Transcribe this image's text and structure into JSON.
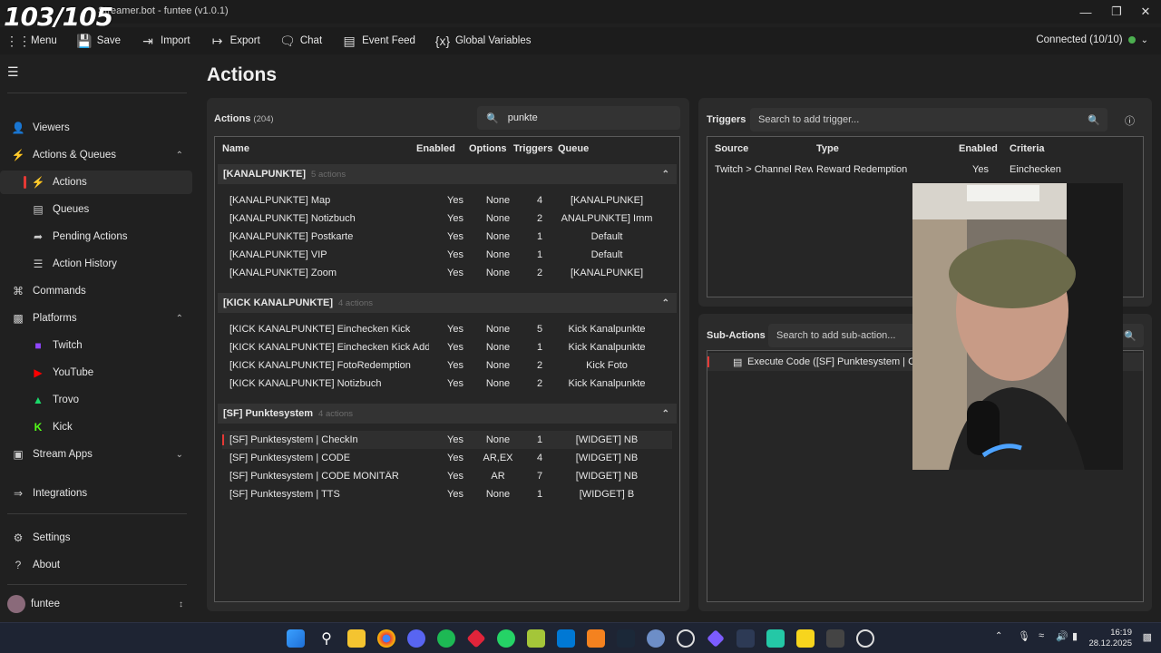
{
  "overlay_counter": "103/105",
  "window": {
    "title": "Streamer.bot - funtee (v1.0.1)"
  },
  "menu": [
    {
      "label": "Menu",
      "icon": "grid-icon"
    },
    {
      "label": "Save",
      "icon": "save-icon"
    },
    {
      "label": "Import",
      "icon": "import-icon"
    },
    {
      "label": "Export",
      "icon": "export-icon"
    },
    {
      "label": "Chat",
      "icon": "chat-icon"
    },
    {
      "label": "Event Feed",
      "icon": "event-feed-icon"
    },
    {
      "label": "Global Variables",
      "icon": "variables-icon"
    }
  ],
  "connection": {
    "label": "Connected (10/10)",
    "color": "#4caf50"
  },
  "sidebar": {
    "items": [
      {
        "label": "Viewers",
        "icon": "viewers-icon"
      },
      {
        "label": "Actions & Queues",
        "icon": "actions-icon"
      },
      {
        "label": "Actions",
        "icon": "bolt-icon"
      },
      {
        "label": "Queues",
        "icon": "queues-icon"
      },
      {
        "label": "Pending Actions",
        "icon": "pending-icon"
      },
      {
        "label": "Action History",
        "icon": "history-icon"
      },
      {
        "label": "Commands",
        "icon": "command-icon"
      },
      {
        "label": "Platforms",
        "icon": "platforms-icon"
      },
      {
        "label": "Twitch",
        "icon": "twitch-icon"
      },
      {
        "label": "YouTube",
        "icon": "youtube-icon"
      },
      {
        "label": "Trovo",
        "icon": "trovo-icon"
      },
      {
        "label": "Kick",
        "icon": "kick-icon"
      },
      {
        "label": "Stream Apps",
        "icon": "stream-apps-icon"
      },
      {
        "label": "Integrations",
        "icon": "integrations-icon"
      },
      {
        "label": "Settings",
        "icon": "settings-icon"
      },
      {
        "label": "About",
        "icon": "about-icon"
      }
    ],
    "user": "funtee"
  },
  "page_title": "Actions",
  "actions": {
    "title": "Actions",
    "count": "(204)",
    "search_value": "punkte",
    "columns": [
      "Name",
      "Enabled",
      "Options",
      "Triggers",
      "Queue"
    ],
    "groups": [
      {
        "name": "[KANALPUNKTE]",
        "count": "5 actions",
        "rows": [
          [
            "[KANALPUNKTE] Map",
            "Yes",
            "None",
            "4",
            "[KANALPUNKE]"
          ],
          [
            "[KANALPUNKTE] Notizbuch",
            "Yes",
            "None",
            "2",
            "ANALPUNKTE] Imm"
          ],
          [
            "[KANALPUNKTE] Postkarte",
            "Yes",
            "None",
            "1",
            "Default"
          ],
          [
            "[KANALPUNKTE] VIP",
            "Yes",
            "None",
            "1",
            "Default"
          ],
          [
            "[KANALPUNKTE] Zoom",
            "Yes",
            "None",
            "2",
            "[KANALPUNKE]"
          ]
        ]
      },
      {
        "name": "[KICK KANALPUNKTE]",
        "count": "4 actions",
        "rows": [
          [
            "[KICK KANALPUNKTE] Einchecken Kick",
            "Yes",
            "None",
            "5",
            "Kick Kanalpunkte"
          ],
          [
            "[KICK KANALPUNKTE] Einchecken Kick Add",
            "Yes",
            "None",
            "1",
            "Kick Kanalpunkte"
          ],
          [
            "[KICK KANALPUNKTE] FotoRedemption",
            "Yes",
            "None",
            "2",
            "Kick Foto"
          ],
          [
            "[KICK KANALPUNKTE] Notizbuch",
            "Yes",
            "None",
            "2",
            "Kick Kanalpunkte"
          ]
        ]
      },
      {
        "name": "[SF] Punktesystem",
        "count": "4 actions",
        "rows": [
          [
            "[SF] Punktesystem | CheckIn",
            "Yes",
            "None",
            "1",
            "[WIDGET] NB"
          ],
          [
            "[SF] Punktesystem | CODE",
            "Yes",
            "AR,EX",
            "4",
            "[WIDGET] NB"
          ],
          [
            "[SF] Punktesystem | CODE MONITÄR",
            "Yes",
            "AR",
            "7",
            "[WIDGET] NB"
          ],
          [
            "[SF] Punktesystem | TTS",
            "Yes",
            "None",
            "1",
            "[WIDGET] B"
          ]
        ]
      }
    ]
  },
  "triggers": {
    "title": "Triggers",
    "search_placeholder": "Search to add trigger...",
    "columns": [
      "Source",
      "Type",
      "Enabled",
      "Criteria"
    ],
    "rows": [
      [
        "Twitch > Channel Rewa",
        "Reward Redemption",
        "Yes",
        "Einchecken"
      ]
    ]
  },
  "subactions": {
    "title": "Sub-Actions",
    "search_placeholder": "Search to add sub-action...",
    "items": [
      "Execute Code ([SF] Punktesystem | CheckIn"
    ]
  },
  "taskbar": {
    "time": "16:19",
    "date": "28.12.2025"
  }
}
